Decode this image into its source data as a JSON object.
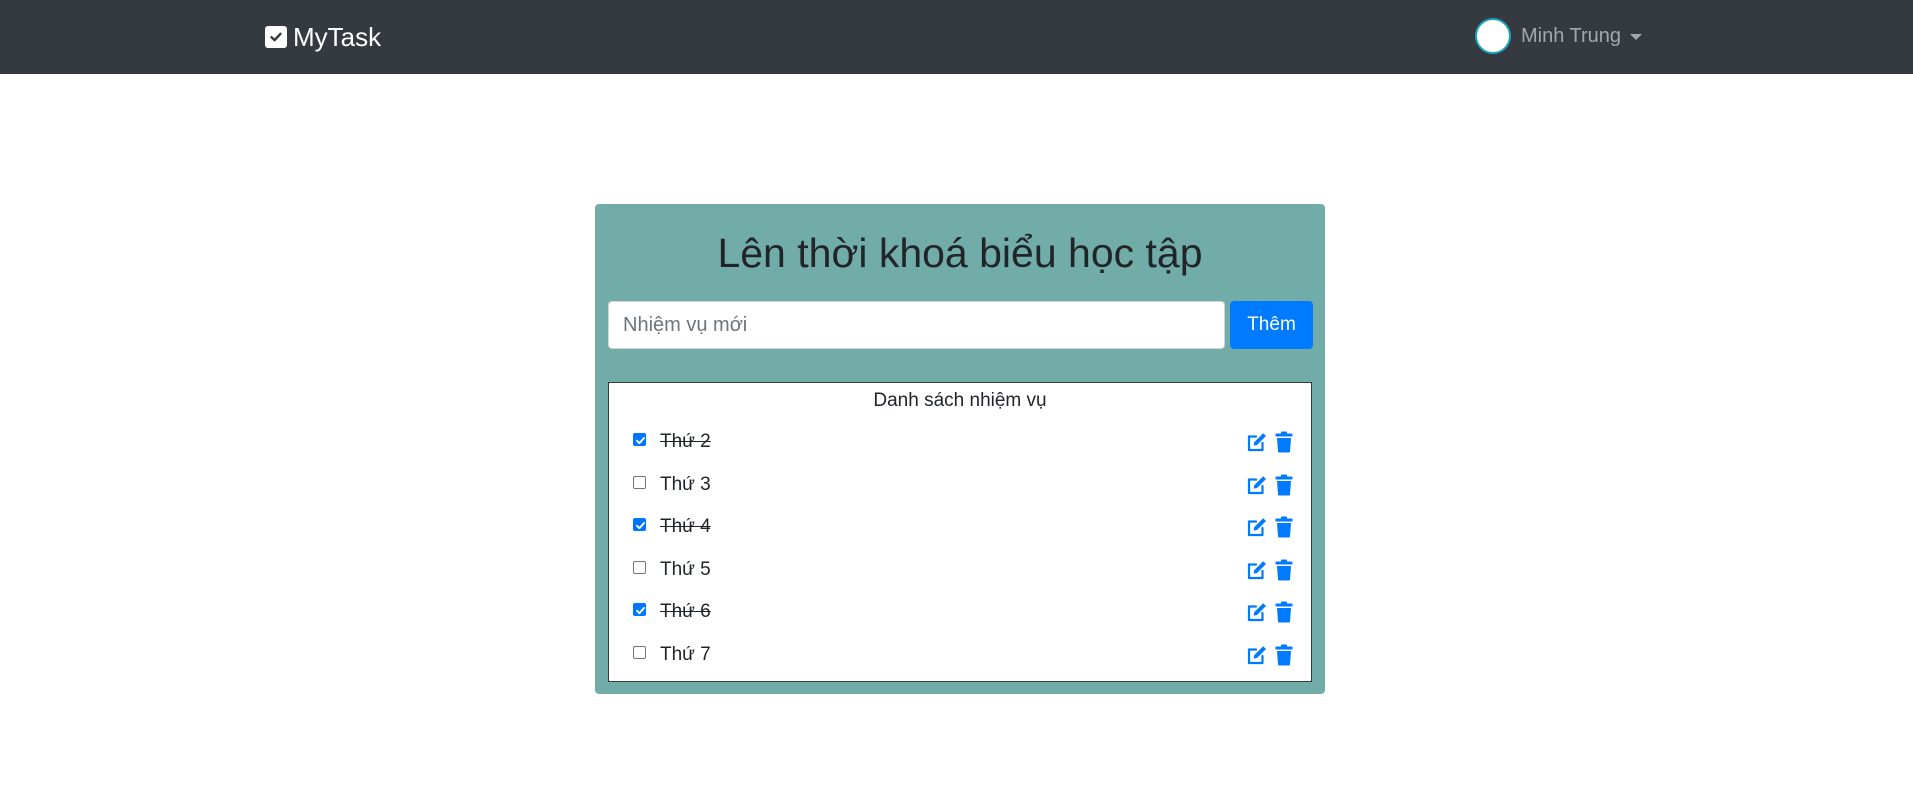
{
  "navbar": {
    "brand": "MyTask",
    "brand_icon": "checkbox-icon",
    "user_name": "Minh Trung"
  },
  "card": {
    "title": "Lên thời khoá biểu học tập",
    "input_placeholder": "Nhiệm vụ mới",
    "input_value": "",
    "add_button_label": "Thêm"
  },
  "task_list": {
    "title": "Danh sách nhiệm vụ",
    "items": [
      {
        "label": "Thứ 2",
        "done": true
      },
      {
        "label": "Thứ 3",
        "done": false
      },
      {
        "label": "Thứ 4",
        "done": true
      },
      {
        "label": "Thứ 5",
        "done": false
      },
      {
        "label": "Thứ 6",
        "done": true
      },
      {
        "label": "Thứ 7",
        "done": false
      }
    ]
  },
  "colors": {
    "navbar_bg": "#343a40",
    "card_bg": "#72aca8",
    "primary": "#007bff",
    "checkbox_checked": "#0075ff"
  },
  "icons": {
    "edit": "edit-icon",
    "delete": "trash-icon",
    "user_menu_caret": "caret-down-icon"
  }
}
